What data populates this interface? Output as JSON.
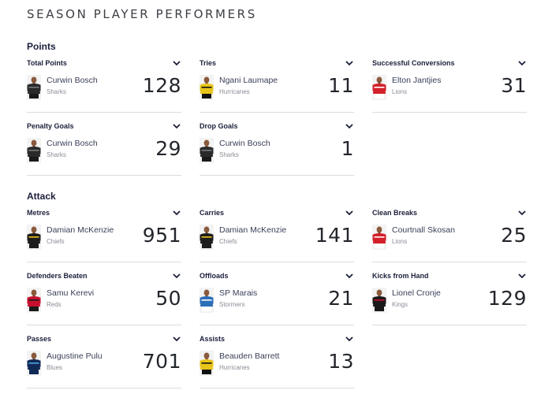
{
  "page": {
    "title": "SEASON PLAYER PERFORMERS"
  },
  "sections": {
    "points": {
      "title": "Points",
      "cards": [
        {
          "title": "Total Points",
          "player": "Curwin Bosch",
          "team": "Sharks",
          "value": "128",
          "kit": {
            "shirt": "#2a2a2a",
            "trim": "#7a7a7a",
            "shorts": "#1a1a1a"
          }
        },
        {
          "title": "Tries",
          "player": "Ngani Laumape",
          "team": "Hurricanes",
          "value": "11",
          "kit": {
            "shirt": "#e8c51a",
            "trim": "#111111",
            "shorts": "#111111"
          }
        },
        {
          "title": "Successful Conversions",
          "player": "Elton Jantjies",
          "team": "Lions",
          "value": "31",
          "kit": {
            "shirt": "#d3202a",
            "trim": "#ffffff",
            "shorts": "#ffffff"
          }
        },
        {
          "title": "Penalty Goals",
          "player": "Curwin Bosch",
          "team": "Sharks",
          "value": "29",
          "kit": {
            "shirt": "#2a2a2a",
            "trim": "#7a7a7a",
            "shorts": "#1a1a1a"
          }
        },
        {
          "title": "Drop Goals",
          "player": "Curwin Bosch",
          "team": "Sharks",
          "value": "1",
          "kit": {
            "shirt": "#2a2a2a",
            "trim": "#7a7a7a",
            "shorts": "#1a1a1a"
          }
        }
      ]
    },
    "attack": {
      "title": "Attack",
      "cards": [
        {
          "title": "Metres",
          "player": "Damian McKenzie",
          "team": "Chiefs",
          "value": "951",
          "kit": {
            "shirt": "#1d1d1d",
            "trim": "#f0c419",
            "shorts": "#1d1d1d"
          }
        },
        {
          "title": "Carries",
          "player": "Damian McKenzie",
          "team": "Chiefs",
          "value": "141",
          "kit": {
            "shirt": "#1d1d1d",
            "trim": "#f0c419",
            "shorts": "#1d1d1d"
          }
        },
        {
          "title": "Clean Breaks",
          "player": "Courtnall Skosan",
          "team": "Lions",
          "value": "25",
          "kit": {
            "shirt": "#d3202a",
            "trim": "#ffffff",
            "shorts": "#ffffff"
          }
        },
        {
          "title": "Defenders Beaten",
          "player": "Samu Kerevi",
          "team": "Reds",
          "value": "50",
          "kit": {
            "shirt": "#c8102e",
            "trim": "#1a1a1a",
            "shorts": "#1a1a1a"
          }
        },
        {
          "title": "Offloads",
          "player": "SP Marais",
          "team": "Stormers",
          "value": "21",
          "kit": {
            "shirt": "#2c6fb7",
            "trim": "#ffffff",
            "shorts": "#ffffff"
          }
        },
        {
          "title": "Kicks from Hand",
          "player": "Lionel Cronje",
          "team": "Kings",
          "value": "129",
          "kit": {
            "shirt": "#1a1a1a",
            "trim": "#c8102e",
            "shorts": "#1a1a1a"
          }
        },
        {
          "title": "Passes",
          "player": "Augustine Pulu",
          "team": "Blues",
          "value": "701",
          "kit": {
            "shirt": "#102a56",
            "trim": "#4fa3e0",
            "shorts": "#102a56"
          }
        },
        {
          "title": "Assists",
          "player": "Beauden Barrett",
          "team": "Hurricanes",
          "value": "13",
          "kit": {
            "shirt": "#e8c51a",
            "trim": "#111111",
            "shorts": "#111111"
          }
        }
      ]
    }
  }
}
